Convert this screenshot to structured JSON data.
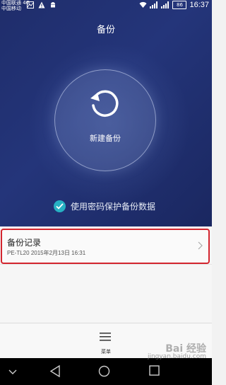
{
  "status_bar": {
    "carrier_line1": "中国联通 4G",
    "carrier_line2": "中国移动",
    "battery": "86",
    "time": "16:37"
  },
  "header": {
    "title": "备份"
  },
  "new_backup": {
    "label": "新建备份",
    "icon": "refresh-arrow-icon"
  },
  "password_protect": {
    "checked": true,
    "label": "使用密码保护备份数据",
    "accent": "#27b1c3"
  },
  "backup_records": {
    "title": "备份记录",
    "entries": [
      {
        "device": "PE-TL20",
        "date": "2015年2月13日 16:31"
      }
    ],
    "highlight_color": "#d3252e"
  },
  "bottom_menu": {
    "label": "菜单",
    "icon": "menu-icon"
  },
  "nav_bar": {
    "items": [
      "collapse-icon",
      "back-icon",
      "home-icon",
      "recents-icon"
    ]
  },
  "watermark": {
    "line1": "Bai 经验",
    "line2": "jingyan.baidu.com"
  },
  "colors": {
    "hero_bg": "#1f2d6b",
    "list_bg": "#f6f6f6"
  }
}
